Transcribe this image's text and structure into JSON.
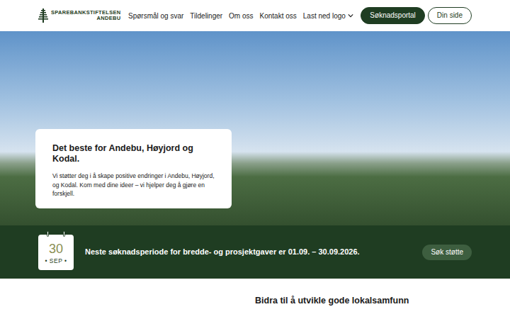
{
  "logo": {
    "line1": "SPAREBANKSTIFTELSEN",
    "line2": "ANDEBU"
  },
  "nav": [
    {
      "label": "Spørsmål og svar",
      "kind": "link"
    },
    {
      "label": "Tildelinger",
      "kind": "link"
    },
    {
      "label": "Om oss",
      "kind": "link"
    },
    {
      "label": "Kontakt oss",
      "kind": "link"
    },
    {
      "label": "Last ned logo",
      "kind": "dropdown"
    }
  ],
  "buttons": [
    {
      "label": "Søknadsportal",
      "kind": "filled"
    },
    {
      "label": "Din side",
      "kind": "outline"
    }
  ],
  "hero": {
    "title": "Det beste for Andebu, Høyjord og Kodal.",
    "text": "Vi støtter deg i å skape positive endringer i Andebu, Høyjord, og Kodal. Kom med dine ideer – vi hjelper deg å gjøre en forskjell."
  },
  "notice": {
    "day": "30",
    "month": "• SEP •",
    "text": "Neste søknadsperiode for bredde- og prosjektgaver er 01.09. – 30.09.2026.",
    "button": "Søk støtte"
  },
  "section": {
    "title": "Bidra til å utvikle gode lokalsamfunn"
  }
}
